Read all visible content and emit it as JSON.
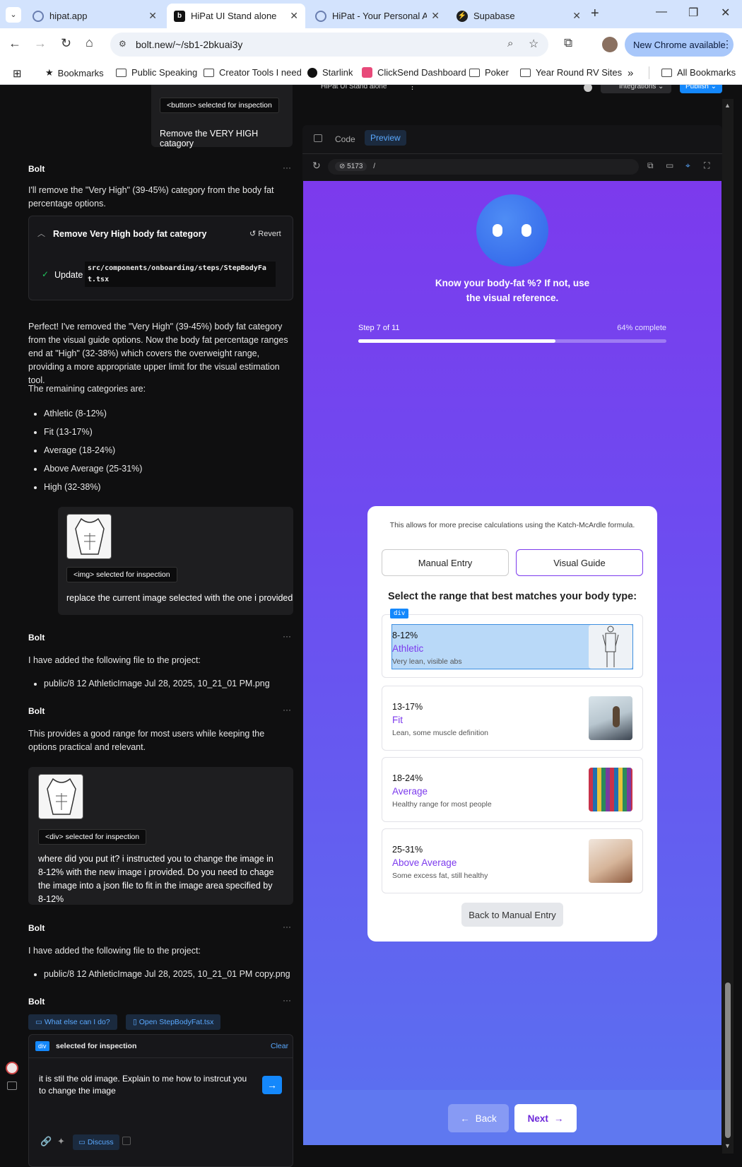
{
  "browser": {
    "tabs": [
      {
        "title": "hipat.app"
      },
      {
        "title": "HiPat UI Stand alone"
      },
      {
        "title": "HiPat - Your Personal AI"
      },
      {
        "title": "Supabase"
      }
    ],
    "url": "bolt.new/~/sb1-2bkuai3y",
    "update_label": "New Chrome available",
    "bookmarks": [
      "Bookmarks",
      "Public Speaking",
      "Creator Tools I need",
      "Starlink",
      "ClickSend Dashboard",
      "Poker",
      "Year Round RV Sites"
    ],
    "more": "»",
    "all_bookmarks": "All Bookmarks"
  },
  "bolt_header": {
    "logo": "bolt",
    "project": "HiPat UI Stand alone",
    "integrations": "Integrations",
    "publish": "Publish"
  },
  "chat": {
    "user_msg1": {
      "tag": "<button> selected for inspection",
      "text": "Remove the VERY HIGH catagory"
    },
    "bolt1": {
      "name": "Bolt",
      "text": "I'll remove the \"Very High\" (39-45%) category from the body fat percentage options.",
      "action_title": "Remove Very High body fat category",
      "revert": "Revert",
      "update_label": "Update",
      "file_path": "src/components/onboarding/steps/StepBodyFat.tsx",
      "summary": "Perfect! I've removed the \"Very High\" (39-45%) body fat category from the visual guide options. Now the body fat percentage ranges end at \"High\" (32-38%) which covers the overweight range, providing a more appropriate upper limit for the visual estimation tool.",
      "remaining_intro": "The remaining categories are:",
      "remaining": [
        "Athletic (8-12%)",
        "Fit (13-17%)",
        "Average (18-24%)",
        "Above Average (25-31%)",
        "High (32-38%)"
      ]
    },
    "user_msg2": {
      "tag": "<img> selected for inspection",
      "text": "replace the current image selected with the one i provided"
    },
    "bolt2": {
      "name": "Bolt",
      "text": "I have added the following file to the project:",
      "file": "public/8 12 AthleticImage Jul 28, 2025, 10_21_01 PM.png"
    },
    "bolt3": {
      "name": "Bolt",
      "text": "This provides a good range for most users while keeping the options practical and relevant."
    },
    "user_msg3": {
      "tag": "<div> selected for inspection",
      "text": "where did you put it? i instructed you to change the image  in 8-12% with the new image i provided. Do you need to chage the image into a json file to fit in the image area specified by 8-12%"
    },
    "bolt4": {
      "name": "Bolt",
      "text": "I have added the following file to the project:",
      "file": "public/8 12 AthleticImage Jul 28, 2025, 10_21_01 PM copy.png"
    },
    "bolt5": {
      "name": "Bolt"
    },
    "suggestions": [
      "What else can I do?",
      "Open StepBodyFat.tsx"
    ],
    "input": {
      "selected_tag": "div",
      "selected_text": "selected for inspection",
      "clear": "Clear",
      "value": "it is stil the old image. Explain to me how to instrcut you to change the image",
      "discuss": "Discuss"
    }
  },
  "preview_toolbar": {
    "code": "Code",
    "preview": "Preview",
    "port": "5173",
    "path": "/"
  },
  "app": {
    "prompt": "Know your body-fat %? If not, use the visual reference.",
    "step": "Step 7 of 11",
    "complete": "64% complete",
    "progress": 0.64,
    "info": "This allows for more precise calculations using the Katch-McArdle formula.",
    "tab_manual": "Manual Entry",
    "tab_visual": "Visual Guide",
    "select_heading": "Select the range that best matches your body type:",
    "div_tag": "div",
    "options": [
      {
        "range": "8-12%",
        "name": "Athletic",
        "desc": "Very lean, visible abs"
      },
      {
        "range": "13-17%",
        "name": "Fit",
        "desc": "Lean, some muscle definition"
      },
      {
        "range": "18-24%",
        "name": "Average",
        "desc": "Healthy range for most people"
      },
      {
        "range": "25-31%",
        "name": "Above Average",
        "desc": "Some excess fat, still healthy"
      }
    ],
    "back_manual": "Back to Manual Entry",
    "back": "Back",
    "next": "Next"
  },
  "colors": {
    "accent": "#7c3aed",
    "bolt_blue": "#1488fc",
    "chrome_tab": "#d3e3fd"
  }
}
